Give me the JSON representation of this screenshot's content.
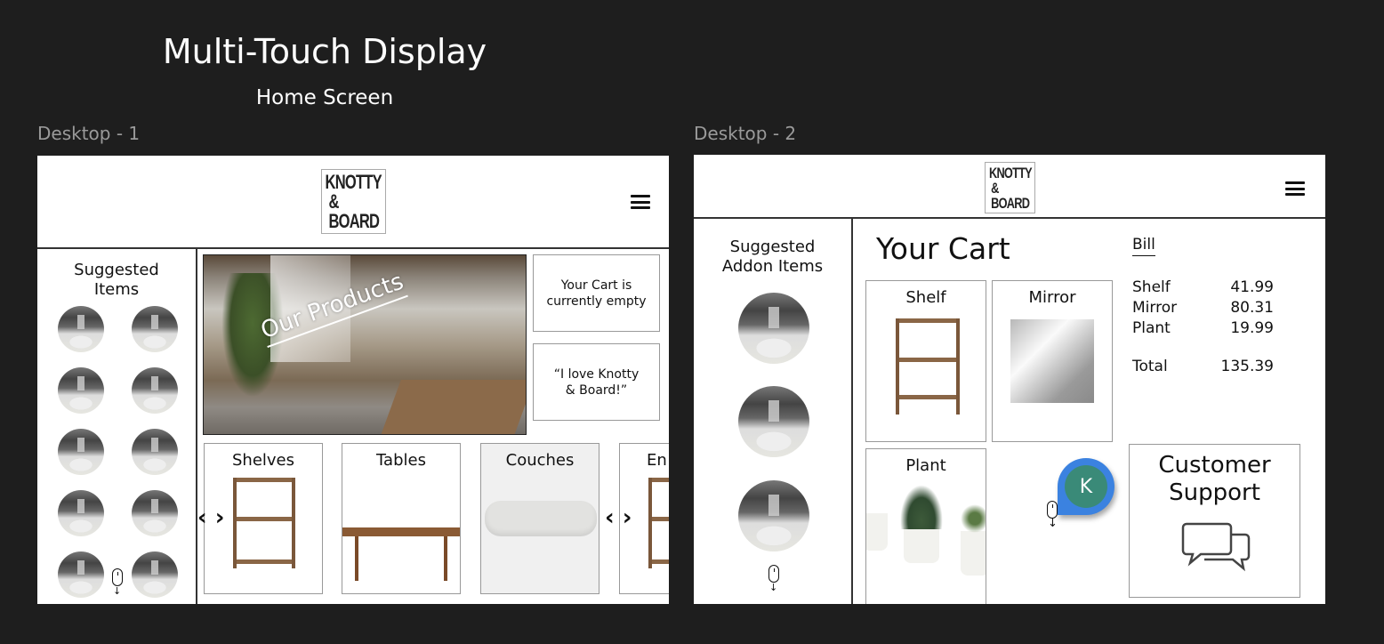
{
  "canvas": {
    "title": "Multi-Touch Display",
    "subtitle": "Home Screen",
    "frames": [
      "Desktop - 1",
      "Desktop - 2"
    ]
  },
  "brand": {
    "line1": "KNOTTY",
    "line2": "& BOARD"
  },
  "home": {
    "sidebar_title_1": "Suggested",
    "sidebar_title_2": "Items",
    "hero_text": "Our Products",
    "cart_text": "Your Cart is currently empty",
    "quote_text": "“I love Knotty & Board!”",
    "carousel_prev": "‹",
    "carousel_next": "›",
    "categories": [
      {
        "label": "Shelves"
      },
      {
        "label": "Tables"
      },
      {
        "label": "Couches"
      },
      {
        "label": "En"
      }
    ]
  },
  "cart": {
    "sidebar_title_1": "Suggested",
    "sidebar_title_2": "Addon Items",
    "title": "Your Cart",
    "items": [
      {
        "label": "Shelf"
      },
      {
        "label": "Mirror"
      },
      {
        "label": "Plant"
      }
    ],
    "bill": {
      "title": "Bill",
      "rows": [
        {
          "name": "Shelf",
          "price": "41.99"
        },
        {
          "name": "Mirror",
          "price": "80.31"
        },
        {
          "name": "Plant",
          "price": "19.99"
        }
      ],
      "total_label": "Total",
      "total": "135.39"
    },
    "support": {
      "label_1": "Customer",
      "label_2": "Support",
      "icon": "chat-bubbles-icon"
    },
    "avatar": {
      "initial": "K",
      "ring_color": "#3b82e0",
      "fill_color": "#3a8a78"
    }
  }
}
